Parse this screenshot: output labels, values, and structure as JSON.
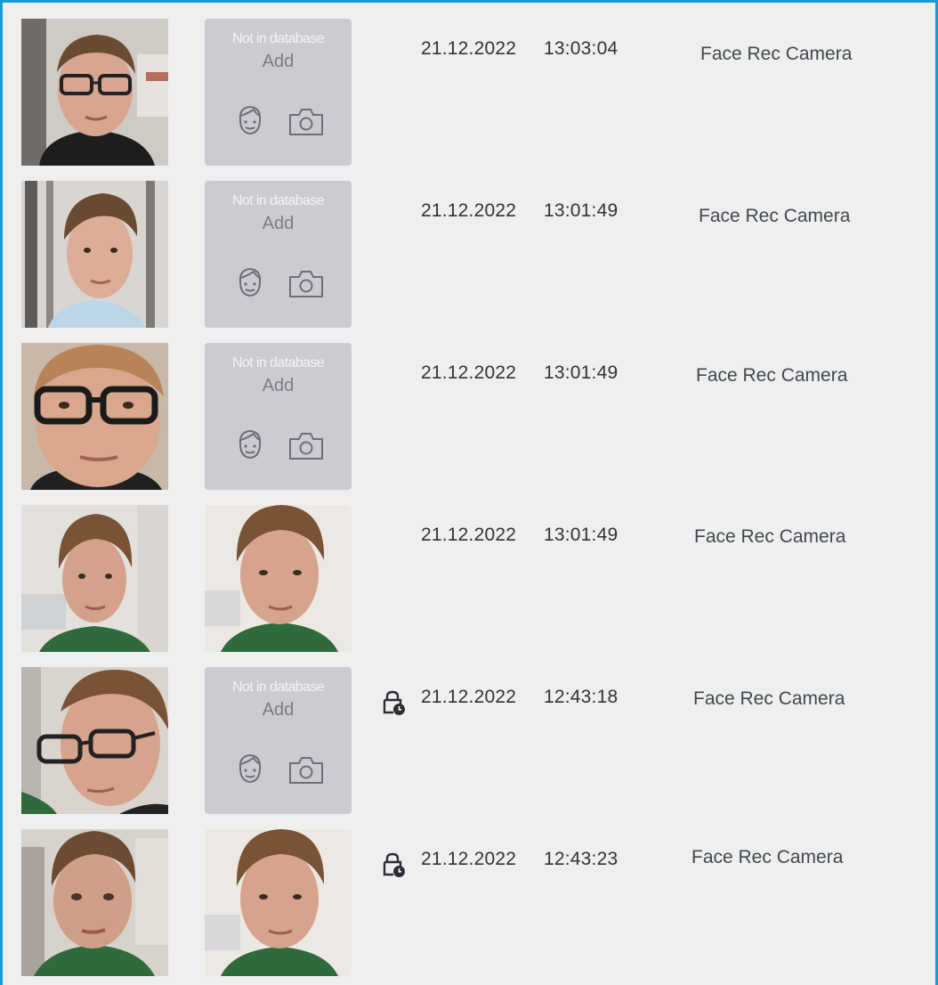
{
  "list": {
    "not_in_db_label": "Not in database",
    "add_label": "Add",
    "events": [
      {
        "date": "21.12.2022",
        "time": "13:03:04",
        "camera": "Face Rec Camera",
        "recognized": false,
        "locked": false
      },
      {
        "date": "21.12.2022",
        "time": "13:01:49",
        "camera": "Face Rec Camera",
        "recognized": false,
        "locked": false
      },
      {
        "date": "21.12.2022",
        "time": "13:01:49",
        "camera": "Face Rec Camera",
        "recognized": false,
        "locked": false
      },
      {
        "date": "21.12.2022",
        "time": "13:01:49",
        "camera": "Face Rec Camera",
        "recognized": true,
        "locked": false
      },
      {
        "date": "21.12.2022",
        "time": "12:43:18",
        "camera": "Face Rec Camera",
        "recognized": false,
        "locked": true
      },
      {
        "date": "21.12.2022",
        "time": "12:43:23",
        "camera": "Face Rec Camera",
        "recognized": true,
        "locked": true
      }
    ]
  },
  "icons": {
    "add_person": "face-add-icon",
    "add_photo": "camera-icon",
    "lock": "lock-clock-icon"
  },
  "colors": {
    "accent_border": "#1c9ad6",
    "background": "#efefef",
    "not_in_db_tile": "#cccbd1"
  }
}
